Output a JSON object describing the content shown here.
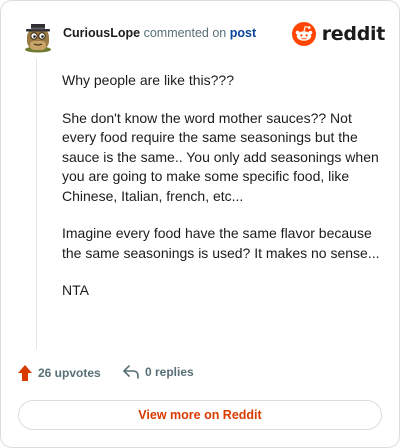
{
  "comment": {
    "author": "CuriousLope",
    "action_text": "commented on",
    "post_link": "post",
    "paragraphs": [
      "Why people are like this???",
      "She don't know the word mother sauces?? Not every food require the same seasonings but the sauce is the same.. You only add seasonings when you are going to make some specific food, like Chinese, Italian, french, etc...",
      "Imagine every food have the same flavor because the same seasonings is used? It makes no sense...",
      "NTA"
    ]
  },
  "brand": {
    "name": "reddit",
    "icon": "reddit-snoo-icon",
    "color": "#ff4500"
  },
  "stats": {
    "upvotes": "26 upvotes",
    "upvote_icon": "upvote-arrow-icon",
    "replies": "0 replies",
    "reply_icon": "reply-arrow-icon"
  },
  "cta": {
    "label": "View more on Reddit"
  }
}
